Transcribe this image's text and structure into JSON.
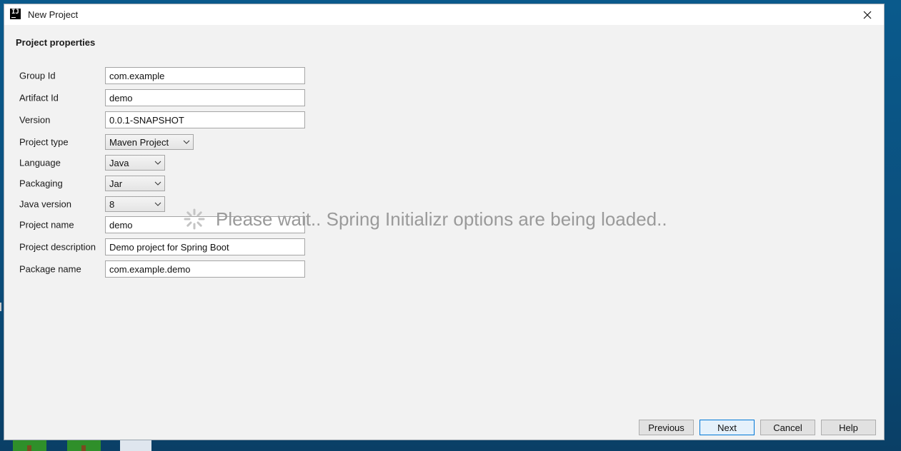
{
  "window": {
    "title": "New Project",
    "app_icon_text": "IJ"
  },
  "section_title": "Project properties",
  "fields": {
    "group_id": {
      "label": "Group Id",
      "value": "com.example"
    },
    "artifact_id": {
      "label": "Artifact Id",
      "value": "demo"
    },
    "version": {
      "label": "Version",
      "value": "0.0.1-SNAPSHOT"
    },
    "project_type": {
      "label": "Project type",
      "value": "Maven Project"
    },
    "language": {
      "label": "Language",
      "value": "Java"
    },
    "packaging": {
      "label": "Packaging",
      "value": "Jar"
    },
    "java_version": {
      "label": "Java version",
      "value": "8"
    },
    "project_name": {
      "label": "Project name",
      "value": "demo"
    },
    "project_description": {
      "label": "Project description",
      "value": "Demo project for Spring Boot"
    },
    "package_name": {
      "label": "Package name",
      "value": "com.example.demo"
    }
  },
  "loading": {
    "message": "Please wait.. Spring Initializr options are being loaded..",
    "icon": "spinner-icon"
  },
  "buttons": {
    "previous": "Previous",
    "next": "Next",
    "cancel": "Cancel",
    "help": "Help"
  },
  "icons": {
    "close": "close-icon",
    "dropdown": "chevron-down-icon",
    "app": "intellij-icon"
  },
  "colors": {
    "dialog_bg": "#f2f2f2",
    "focus_border": "#0078d7",
    "loading_text": "#9a9a9a"
  }
}
